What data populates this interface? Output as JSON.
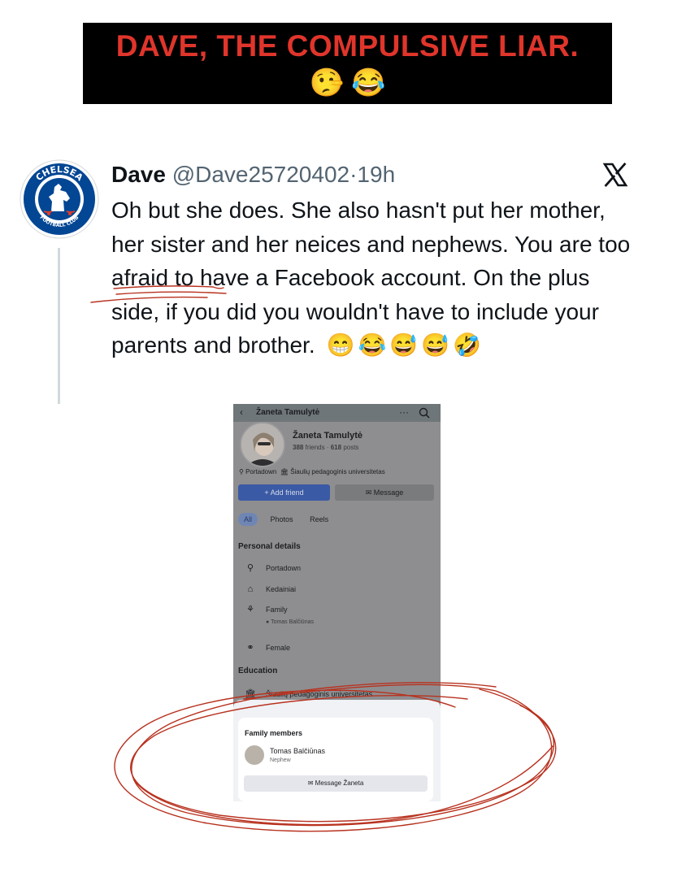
{
  "banner": {
    "title": "DAVE, THE COMPULSIVE LIAR.",
    "emojis": "🤥 😂"
  },
  "tweet": {
    "avatar_icon": "chelsea-fc-crest-icon",
    "avatar_logo_text": "CHELSEA FOOTBALL CLUB",
    "name": "Dave",
    "handle": "@Dave25720402",
    "separator": "·",
    "time": "19h",
    "platform_icon": "x-logo-icon",
    "text": "Oh but she does. She also hasn't put her mother, her sister and her neices and nephews. You are too afraid to have a Facebook account.  On the plus side, if you did you wouldn't have to include your parents and brother.",
    "emojis": "😁😂😅😅🤣"
  },
  "facebook": {
    "top_name": "Žaneta Tamulytė",
    "profile_name": "Žaneta Tamulytė",
    "friends": "388",
    "friends_label": "friends",
    "posts": "618",
    "posts_label": "posts",
    "location": "Portadown",
    "school": "Šiaulių pedagoginis universitetas",
    "add_friend": "Add friend",
    "message": "Message",
    "tabs": [
      "All",
      "Photos",
      "Reels"
    ],
    "personal_details_title": "Personal details",
    "details": [
      {
        "icon": "location-pin-icon",
        "label": "Portadown"
      },
      {
        "icon": "home-icon",
        "label": "Kedainiai"
      },
      {
        "icon": "family-icon",
        "label": "Family",
        "sub": "Tomas Balčiūnas"
      },
      {
        "icon": "gender-icon",
        "label": "Female"
      }
    ],
    "education_title": "Education",
    "education_item": "Šiaulių pedagoginis universitetas",
    "family_title": "Family members",
    "member_name": "Tomas Balčiūnas",
    "member_relation": "Nephew",
    "message_button": "Message Žaneta"
  },
  "colors": {
    "banner_text": "#e0352b",
    "fb_blue": "#3b5aa5",
    "annotation_red": "#b8321f",
    "chelsea_blue": "#034694"
  }
}
